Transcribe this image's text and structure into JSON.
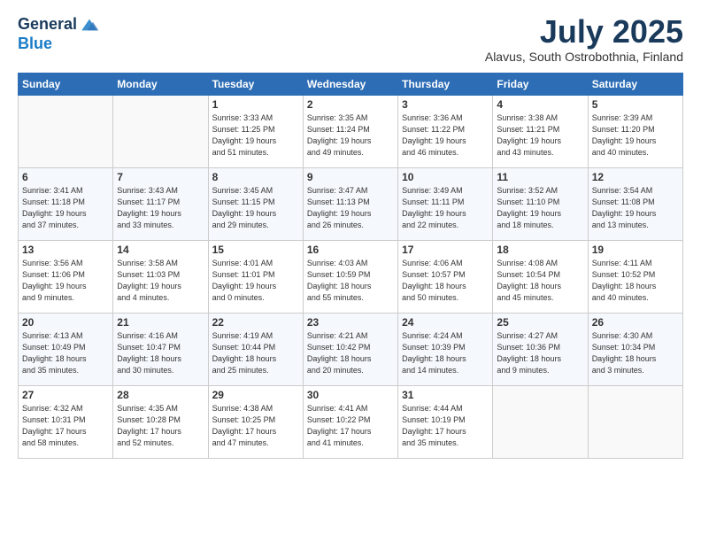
{
  "header": {
    "logo_line1": "General",
    "logo_line2": "Blue",
    "month_title": "July 2025",
    "subtitle": "Alavus, South Ostrobothnia, Finland"
  },
  "weekdays": [
    "Sunday",
    "Monday",
    "Tuesday",
    "Wednesday",
    "Thursday",
    "Friday",
    "Saturday"
  ],
  "weeks": [
    [
      {
        "day": "",
        "info": ""
      },
      {
        "day": "",
        "info": ""
      },
      {
        "day": "1",
        "info": "Sunrise: 3:33 AM\nSunset: 11:25 PM\nDaylight: 19 hours\nand 51 minutes."
      },
      {
        "day": "2",
        "info": "Sunrise: 3:35 AM\nSunset: 11:24 PM\nDaylight: 19 hours\nand 49 minutes."
      },
      {
        "day": "3",
        "info": "Sunrise: 3:36 AM\nSunset: 11:22 PM\nDaylight: 19 hours\nand 46 minutes."
      },
      {
        "day": "4",
        "info": "Sunrise: 3:38 AM\nSunset: 11:21 PM\nDaylight: 19 hours\nand 43 minutes."
      },
      {
        "day": "5",
        "info": "Sunrise: 3:39 AM\nSunset: 11:20 PM\nDaylight: 19 hours\nand 40 minutes."
      }
    ],
    [
      {
        "day": "6",
        "info": "Sunrise: 3:41 AM\nSunset: 11:18 PM\nDaylight: 19 hours\nand 37 minutes."
      },
      {
        "day": "7",
        "info": "Sunrise: 3:43 AM\nSunset: 11:17 PM\nDaylight: 19 hours\nand 33 minutes."
      },
      {
        "day": "8",
        "info": "Sunrise: 3:45 AM\nSunset: 11:15 PM\nDaylight: 19 hours\nand 29 minutes."
      },
      {
        "day": "9",
        "info": "Sunrise: 3:47 AM\nSunset: 11:13 PM\nDaylight: 19 hours\nand 26 minutes."
      },
      {
        "day": "10",
        "info": "Sunrise: 3:49 AM\nSunset: 11:11 PM\nDaylight: 19 hours\nand 22 minutes."
      },
      {
        "day": "11",
        "info": "Sunrise: 3:52 AM\nSunset: 11:10 PM\nDaylight: 19 hours\nand 18 minutes."
      },
      {
        "day": "12",
        "info": "Sunrise: 3:54 AM\nSunset: 11:08 PM\nDaylight: 19 hours\nand 13 minutes."
      }
    ],
    [
      {
        "day": "13",
        "info": "Sunrise: 3:56 AM\nSunset: 11:06 PM\nDaylight: 19 hours\nand 9 minutes."
      },
      {
        "day": "14",
        "info": "Sunrise: 3:58 AM\nSunset: 11:03 PM\nDaylight: 19 hours\nand 4 minutes."
      },
      {
        "day": "15",
        "info": "Sunrise: 4:01 AM\nSunset: 11:01 PM\nDaylight: 19 hours\nand 0 minutes."
      },
      {
        "day": "16",
        "info": "Sunrise: 4:03 AM\nSunset: 10:59 PM\nDaylight: 18 hours\nand 55 minutes."
      },
      {
        "day": "17",
        "info": "Sunrise: 4:06 AM\nSunset: 10:57 PM\nDaylight: 18 hours\nand 50 minutes."
      },
      {
        "day": "18",
        "info": "Sunrise: 4:08 AM\nSunset: 10:54 PM\nDaylight: 18 hours\nand 45 minutes."
      },
      {
        "day": "19",
        "info": "Sunrise: 4:11 AM\nSunset: 10:52 PM\nDaylight: 18 hours\nand 40 minutes."
      }
    ],
    [
      {
        "day": "20",
        "info": "Sunrise: 4:13 AM\nSunset: 10:49 PM\nDaylight: 18 hours\nand 35 minutes."
      },
      {
        "day": "21",
        "info": "Sunrise: 4:16 AM\nSunset: 10:47 PM\nDaylight: 18 hours\nand 30 minutes."
      },
      {
        "day": "22",
        "info": "Sunrise: 4:19 AM\nSunset: 10:44 PM\nDaylight: 18 hours\nand 25 minutes."
      },
      {
        "day": "23",
        "info": "Sunrise: 4:21 AM\nSunset: 10:42 PM\nDaylight: 18 hours\nand 20 minutes."
      },
      {
        "day": "24",
        "info": "Sunrise: 4:24 AM\nSunset: 10:39 PM\nDaylight: 18 hours\nand 14 minutes."
      },
      {
        "day": "25",
        "info": "Sunrise: 4:27 AM\nSunset: 10:36 PM\nDaylight: 18 hours\nand 9 minutes."
      },
      {
        "day": "26",
        "info": "Sunrise: 4:30 AM\nSunset: 10:34 PM\nDaylight: 18 hours\nand 3 minutes."
      }
    ],
    [
      {
        "day": "27",
        "info": "Sunrise: 4:32 AM\nSunset: 10:31 PM\nDaylight: 17 hours\nand 58 minutes."
      },
      {
        "day": "28",
        "info": "Sunrise: 4:35 AM\nSunset: 10:28 PM\nDaylight: 17 hours\nand 52 minutes."
      },
      {
        "day": "29",
        "info": "Sunrise: 4:38 AM\nSunset: 10:25 PM\nDaylight: 17 hours\nand 47 minutes."
      },
      {
        "day": "30",
        "info": "Sunrise: 4:41 AM\nSunset: 10:22 PM\nDaylight: 17 hours\nand 41 minutes."
      },
      {
        "day": "31",
        "info": "Sunrise: 4:44 AM\nSunset: 10:19 PM\nDaylight: 17 hours\nand 35 minutes."
      },
      {
        "day": "",
        "info": ""
      },
      {
        "day": "",
        "info": ""
      }
    ]
  ]
}
